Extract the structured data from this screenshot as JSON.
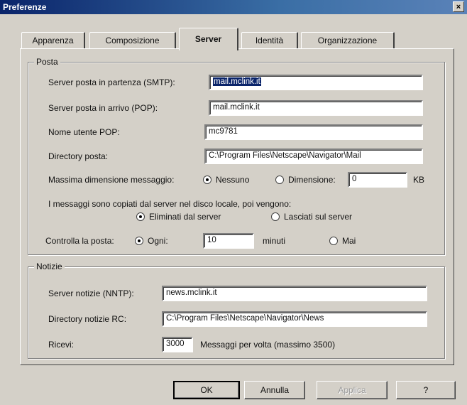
{
  "window": {
    "title": "Preferenze",
    "close_label": "×"
  },
  "tabs": [
    {
      "label": "Apparenza"
    },
    {
      "label": "Composizione"
    },
    {
      "label": "Server"
    },
    {
      "label": "Identità"
    },
    {
      "label": "Organizzazione"
    }
  ],
  "posta": {
    "title": "Posta",
    "smtp_label": "Server posta in partenza (SMTP):",
    "smtp_value": "mail.mclink.it",
    "pop_label": "Server posta in arrivo (POP):",
    "pop_value": "mail.mclink.it",
    "user_label": "Nome utente POP:",
    "user_value": "mc9781",
    "dir_label": "Directory posta:",
    "dir_value": "C:\\Program Files\\Netscape\\Navigator\\Mail",
    "maxsize_label": "Massima dimensione messaggio:",
    "maxsize_none": "Nessuno",
    "maxsize_size": "Dimensione:",
    "maxsize_value": "0",
    "maxsize_unit": "KB",
    "copy_note": "I messaggi sono copiati dal server nel disco locale, poi vengono:",
    "delete_option": "Eliminati dal server",
    "keep_option": "Lasciati sul server",
    "check_label": "Controlla la posta:",
    "check_every": "Ogni:",
    "check_value": "10",
    "check_unit": "minuti",
    "check_never": "Mai"
  },
  "notizie": {
    "title": "Notizie",
    "nntp_label": "Server notizie (NNTP):",
    "nntp_value": "news.mclink.it",
    "dir_label": "Directory notizie RC:",
    "dir_value": "C:\\Program Files\\Netscape\\Navigator\\News",
    "receive_label": "Ricevi:",
    "receive_value": "3000",
    "receive_note": "Messaggi per volta (massimo 3500)"
  },
  "buttons": {
    "ok": "OK",
    "cancel": "Annulla",
    "apply": "Applica",
    "help": "?"
  }
}
